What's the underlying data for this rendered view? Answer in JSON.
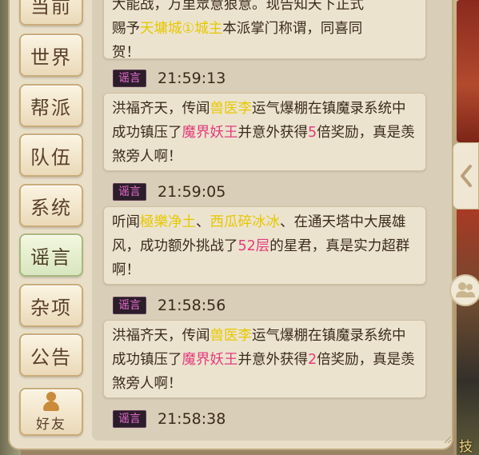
{
  "tabs": {
    "current": "当前",
    "world": "世界",
    "faction": "帮派",
    "team": "队伍",
    "system": "系统",
    "rumor": "谣言",
    "misc": "杂项",
    "notice": "公告",
    "friends": "好友"
  },
  "messages": {
    "top": {
      "line1": "大能战，万里眾意狠意。现告知天下正式",
      "l2_pre": "赐予",
      "l2_hl": "天墉城①城主",
      "l2_post": "本派掌门称谓，同喜同",
      "line3": "贺！"
    },
    "m1": {
      "badge": "谣言",
      "time": "21:59:13",
      "t1": "洪福齐天，传闻",
      "t2": "兽医李",
      "t3": "运气爆棚在镇魔录系统中成功镇压了",
      "t4": "魔界妖王",
      "t5": "并意外获得",
      "t6": "5",
      "t7": "倍奖励，真是羡煞旁人啊！"
    },
    "m2": {
      "badge": "谣言",
      "time": "21:59:05",
      "t1": "听闻",
      "t2": "極樂净土",
      "t3": "、",
      "t4": "西瓜碎冰冰",
      "t5": "、在通天塔中大展雄风，成功额外挑战了",
      "t6": "52层",
      "t7": "的星君，真是实力超群啊！"
    },
    "m3": {
      "badge": "谣言",
      "time": "21:58:56",
      "t1": "洪福齐天，传闻",
      "t2": "兽医李",
      "t3": "运气爆棚在镇魔录系统中成功镇压了",
      "t4": "魔界妖王",
      "t5": "并意外获得",
      "t6": "2",
      "t7": "倍奖励，真是羡煞旁人啊！"
    },
    "m4": {
      "badge": "谣言",
      "time": "21:58:38"
    }
  },
  "corner_text": "技",
  "icons": {
    "collapse": "chevron-left-icon",
    "voice": "people-icon",
    "friends": "person-icon"
  },
  "colors": {
    "highlight_yellow": "#e6c800",
    "highlight_pink": "#e23c7c",
    "badge_text": "#e96fd1"
  }
}
